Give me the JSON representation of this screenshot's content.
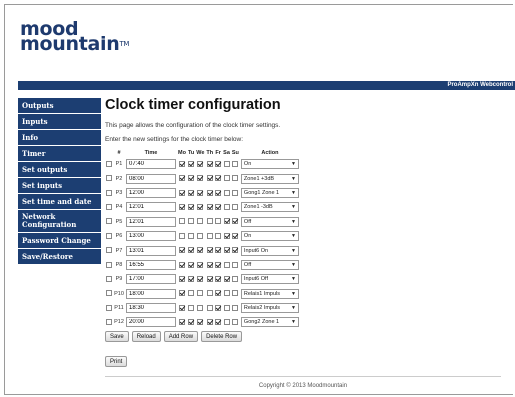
{
  "logo": {
    "line1": "mood",
    "line2": "mountain",
    "tm": "TM"
  },
  "header": {
    "right_text": "ProAmpXn Webcontrol"
  },
  "sidebar": {
    "items": [
      {
        "label": "Outputs"
      },
      {
        "label": "Inputs"
      },
      {
        "label": "Info"
      },
      {
        "label": "Timer"
      },
      {
        "label": "Set outputs"
      },
      {
        "label": "Set inputs"
      },
      {
        "label": "Set time and date"
      },
      {
        "label": "Network Configuration"
      },
      {
        "label": "Password Change"
      },
      {
        "label": "Save/Restore"
      }
    ]
  },
  "main": {
    "title": "Clock timer configuration",
    "description": "This page allows the configuration of the clock timer settings.",
    "instruction": "Enter the new settings for the clock timer below:",
    "columns": {
      "num": "#",
      "time": "Time",
      "days": [
        "Mo",
        "Tu",
        "We",
        "Th",
        "Fr",
        "Sa",
        "Su"
      ],
      "action": "Action"
    },
    "rows": [
      {
        "label": "P1",
        "time": "07:40",
        "days": [
          1,
          1,
          1,
          1,
          1,
          0,
          0
        ],
        "action": "On"
      },
      {
        "label": "P2",
        "time": "08:00",
        "days": [
          1,
          1,
          1,
          1,
          1,
          0,
          0
        ],
        "action": "Zone1 +3dB"
      },
      {
        "label": "P3",
        "time": "12:00",
        "days": [
          1,
          1,
          1,
          1,
          1,
          0,
          0
        ],
        "action": "Gong1 Zone 1"
      },
      {
        "label": "P4",
        "time": "12:01",
        "days": [
          1,
          1,
          1,
          1,
          1,
          0,
          0
        ],
        "action": "Zone1 -3dB"
      },
      {
        "label": "P5",
        "time": "12:01",
        "days": [
          0,
          0,
          0,
          0,
          0,
          1,
          1
        ],
        "action": "Off"
      },
      {
        "label": "P6",
        "time": "13:00",
        "days": [
          0,
          0,
          0,
          0,
          0,
          1,
          1
        ],
        "action": "On"
      },
      {
        "label": "P7",
        "time": "13:01",
        "days": [
          1,
          1,
          1,
          1,
          1,
          1,
          1
        ],
        "action": "Input6 On"
      },
      {
        "label": "P8",
        "time": "16:55",
        "days": [
          1,
          1,
          1,
          1,
          1,
          0,
          0
        ],
        "action": "Off"
      },
      {
        "label": "P9",
        "time": "17:00",
        "days": [
          1,
          1,
          1,
          1,
          1,
          1,
          0
        ],
        "action": "Input6 Off"
      },
      {
        "label": "P10",
        "time": "18:00",
        "days": [
          1,
          0,
          0,
          0,
          1,
          0,
          0
        ],
        "action": "Relais1 Impuls"
      },
      {
        "label": "P11",
        "time": "18:30",
        "days": [
          1,
          0,
          0,
          0,
          1,
          0,
          0
        ],
        "action": "Relais2 Impuls"
      },
      {
        "label": "P12",
        "time": "20:00",
        "days": [
          1,
          1,
          1,
          1,
          1,
          0,
          0
        ],
        "action": "Gong2 Zone 1"
      }
    ],
    "buttons": {
      "save": "Save",
      "reload": "Reload",
      "add_row": "Add Row",
      "delete_row": "Delete Row",
      "print": "Print"
    }
  },
  "footer": {
    "copyright": "Copyright © 2013 Moodmountain"
  },
  "colors": {
    "navy": "#1c3e72",
    "logo": "#1e3a6e"
  }
}
